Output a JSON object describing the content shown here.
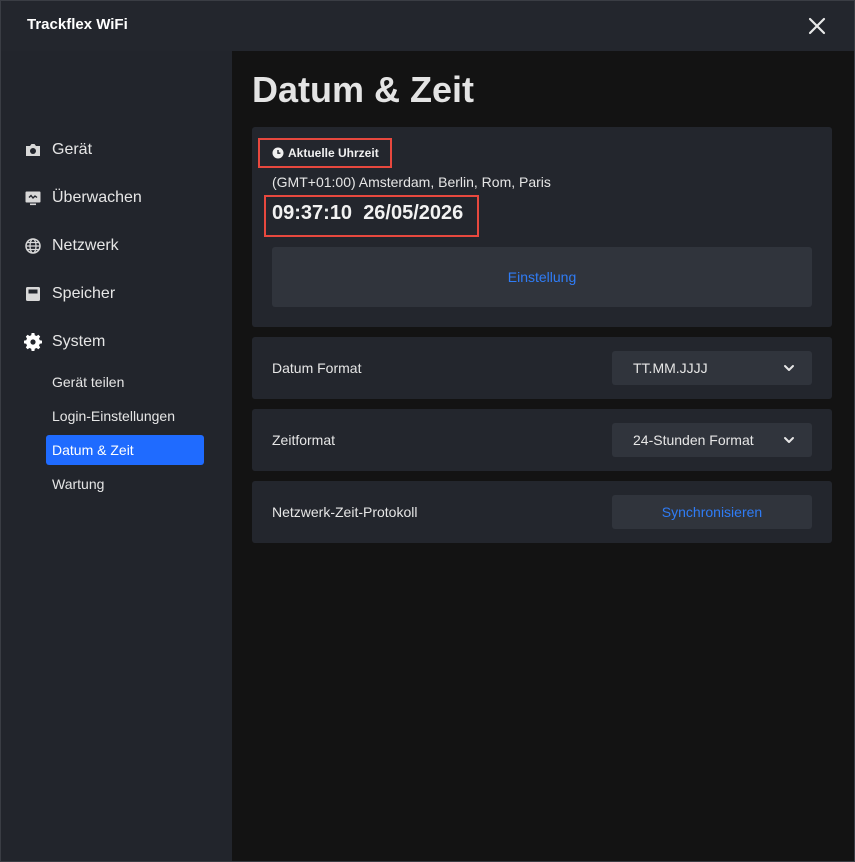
{
  "app": {
    "title": "Trackflex WiFi"
  },
  "sidebar": {
    "items": [
      {
        "label": "Gerät",
        "icon": "camera-icon"
      },
      {
        "label": "Überwachen",
        "icon": "monitor-icon"
      },
      {
        "label": "Netzwerk",
        "icon": "globe-icon"
      },
      {
        "label": "Speicher",
        "icon": "storage-icon"
      },
      {
        "label": "System",
        "icon": "gear-icon"
      }
    ],
    "subitems": [
      {
        "label": "Gerät teilen"
      },
      {
        "label": "Login-Einstellungen"
      },
      {
        "label": "Datum & Zeit",
        "active": true
      },
      {
        "label": "Wartung"
      }
    ]
  },
  "main": {
    "title": "Datum & Zeit",
    "current_time": {
      "badge": "Aktuelle Uhrzeit",
      "timezone": "(GMT+01:00) Amsterdam, Berlin, Rom, Paris",
      "time": "09:37:10",
      "date": "26/05/2026",
      "settings_button": "Einstellung"
    },
    "date_format": {
      "label": "Datum Format",
      "value": "TT.MM.JJJJ"
    },
    "time_format": {
      "label": "Zeitformat",
      "value": "24-Stunden Format"
    },
    "ntp": {
      "label": "Netzwerk-Zeit-Protokoll",
      "button": "Synchronisieren"
    }
  },
  "colors": {
    "accent": "#1f6bff",
    "link": "#2f7cf6",
    "highlight": "#e8483e"
  }
}
